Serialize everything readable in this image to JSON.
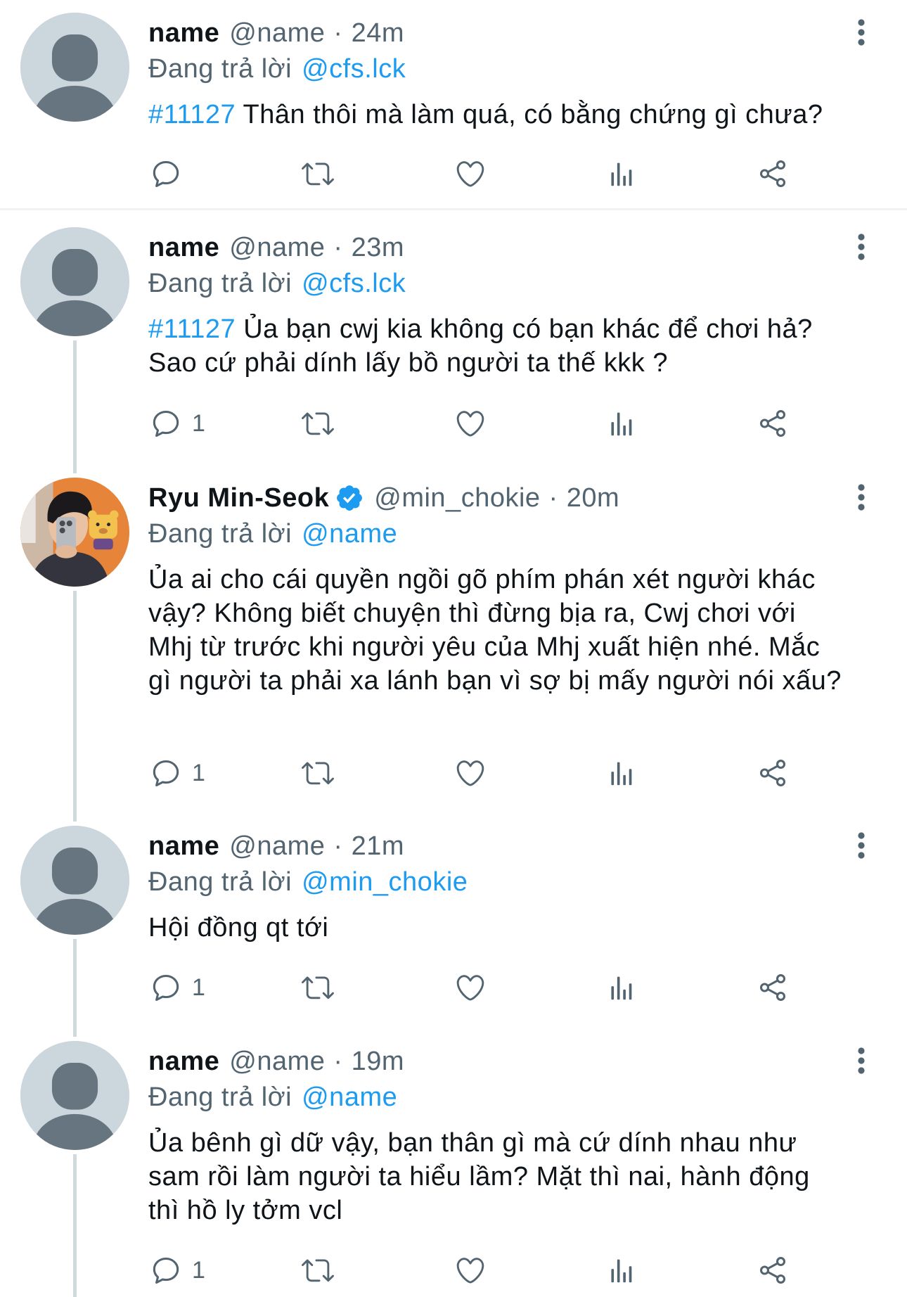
{
  "labels": {
    "replying_to": "Đang trả lời",
    "separator": "·"
  },
  "colors": {
    "background": "#ffffff",
    "text": "#0f1419",
    "secondary_text": "#536471",
    "link": "#1d9bf0",
    "verified_badge": "#1d9bf0",
    "divider": "#eff3f4",
    "thread_line": "#cfd9de",
    "default_avatar_bg": "#ccd6dd",
    "default_avatar_fg": "#66757f"
  },
  "icons": {
    "reply": "reply-icon",
    "retweet": "retweet-icon",
    "like": "like-icon",
    "views": "views-icon",
    "share": "share-icon",
    "more": "more-options-icon",
    "verified": "verified-badge-icon"
  },
  "tweets": [
    {
      "name": "name",
      "handle": "@name",
      "time": "24m",
      "reply_to": "@cfs.lck",
      "hashtag": "#11127",
      "lines": [
        "Thân thôi mà làm quá, có bằng chứng gì chưa?"
      ]
    },
    {
      "name": "name",
      "handle": "@name",
      "time": "23m",
      "reply_to": "@cfs.lck",
      "hashtag": "#11127",
      "lines": [
        "Ủa bạn cwj kia không có bạn khác để chơi hả?",
        "Sao cứ phải dính lấy bồ người ta thế kkk ?"
      ],
      "reply_count": "1"
    },
    {
      "name": "Ryu Min-Seok",
      "verified": true,
      "handle": "@min_chokie",
      "time": "20m",
      "reply_to": "@name",
      "lines": [
        "Ủa ai cho cái quyền ngồi gõ phím phán xét người khác",
        "vậy? Không biết chuyện thì đừng bịa ra, Cwj chơi với",
        "Mhj từ trước khi người yêu của Mhj xuất hiện nhé. Mắc",
        "gì người ta phải xa lánh bạn vì sợ bị mấy người nói xấu?"
      ],
      "reply_count": "1"
    },
    {
      "name": "name",
      "handle": "@name",
      "time": "21m",
      "reply_to": "@min_chokie",
      "lines": [
        "Hội đồng qt tới"
      ],
      "reply_count": "1"
    },
    {
      "name": "name",
      "handle": "@name",
      "time": "19m",
      "reply_to": "@name",
      "lines": [
        "Ủa bênh gì dữ vậy, bạn thân gì mà cứ dính nhau như",
        "sam rồi làm người ta hiểu lầm? Mặt thì nai, hành động",
        "thì hồ ly tởm vcl"
      ],
      "reply_count": "1"
    }
  ]
}
